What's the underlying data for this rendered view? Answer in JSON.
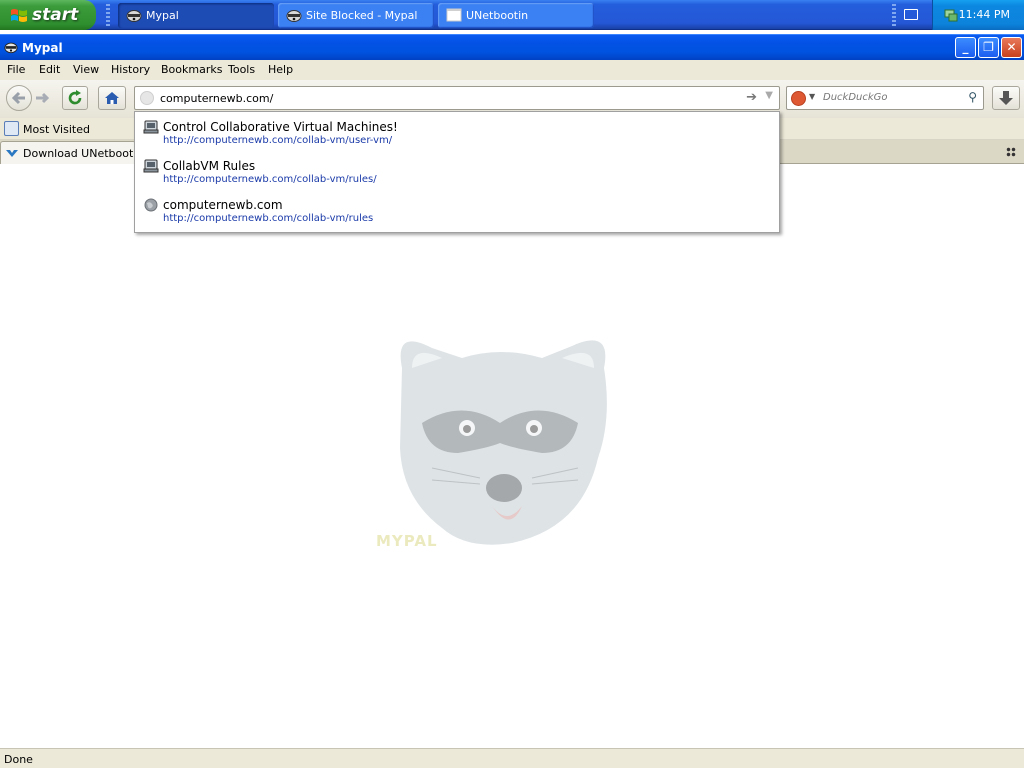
{
  "taskbar": {
    "start_label": "start",
    "tasks": [
      {
        "label": "Mypal",
        "icon": "raccoon-icon"
      },
      {
        "label": "Site Blocked - Mypal",
        "icon": "raccoon-icon"
      },
      {
        "label": "UNetbootin",
        "icon": "window-icon"
      }
    ],
    "clock": "11:44 PM"
  },
  "window": {
    "title": "Mypal"
  },
  "menu": [
    "File",
    "Edit",
    "View",
    "History",
    "Bookmarks",
    "Tools",
    "Help"
  ],
  "navbar": {
    "url": "computernewb.com/",
    "search_placeholder": "DuckDuckGo"
  },
  "bookmarks": {
    "most_visited": "Most Visited"
  },
  "tabs": [
    {
      "label": "Download UNetbootin 3"
    }
  ],
  "autocomplete": [
    {
      "title": "Control Collaborative Virtual Machines!",
      "url": "http://computernewb.com/collab-vm/user-vm/",
      "icon": "vm-icon"
    },
    {
      "title": "CollabVM Rules",
      "url": "http://computernewb.com/collab-vm/rules/",
      "icon": "vm-icon"
    },
    {
      "title": "computernewb.com",
      "url": "http://computernewb.com/collab-vm/rules",
      "icon": "globe-icon"
    }
  ],
  "content": {
    "logo_text": "MYPAL"
  },
  "status": "Done",
  "colors": {
    "taskbar": "#245edc",
    "titlebar": "#0052df",
    "start": "#3c9c3c",
    "chrome": "#ece9d8",
    "link": "#1a3aa8"
  }
}
